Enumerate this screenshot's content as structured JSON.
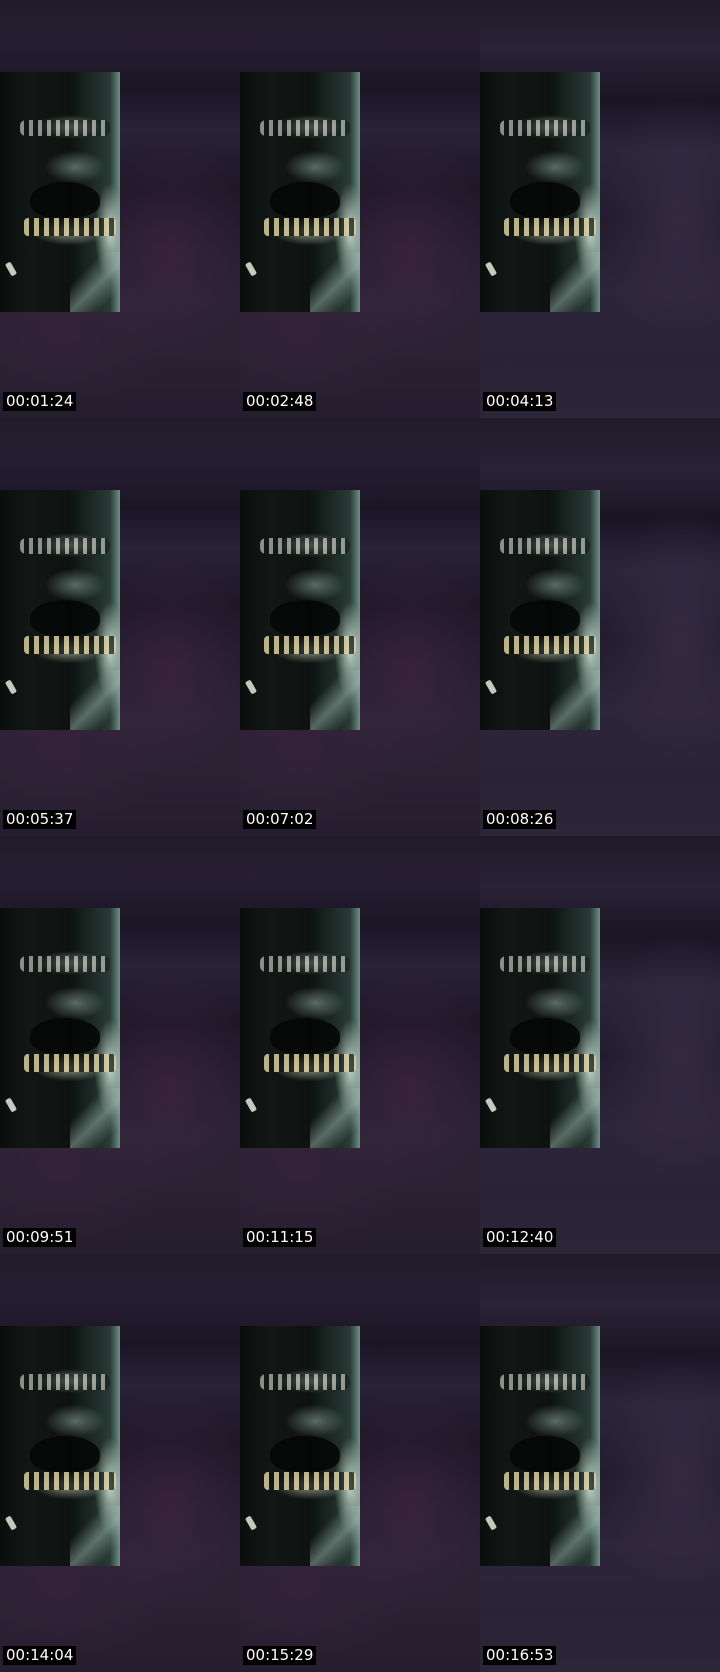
{
  "thumbnails": [
    {
      "timestamp": "00:01:24"
    },
    {
      "timestamp": "00:02:48"
    },
    {
      "timestamp": "00:04:13"
    },
    {
      "timestamp": "00:05:37"
    },
    {
      "timestamp": "00:07:02"
    },
    {
      "timestamp": "00:08:26"
    },
    {
      "timestamp": "00:09:51"
    },
    {
      "timestamp": "00:11:15"
    },
    {
      "timestamp": "00:12:40"
    },
    {
      "timestamp": "00:14:04"
    },
    {
      "timestamp": "00:15:29"
    },
    {
      "timestamp": "00:16:53"
    }
  ]
}
